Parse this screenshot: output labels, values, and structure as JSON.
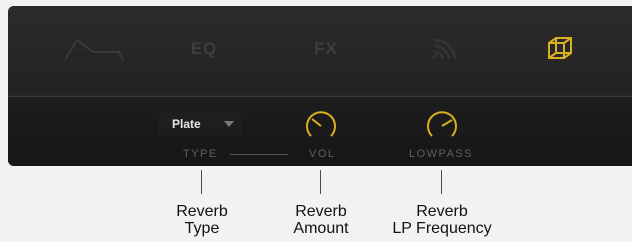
{
  "tabs": [
    {
      "id": "envelope",
      "label": "",
      "icon": "envelope-icon"
    },
    {
      "id": "eq",
      "label": "EQ",
      "icon": ""
    },
    {
      "id": "fx",
      "label": "FX",
      "icon": ""
    },
    {
      "id": "delay",
      "label": "",
      "icon": "delay-waves-icon"
    },
    {
      "id": "reverb",
      "label": "",
      "icon": "reverb-cube-icon",
      "active": true
    }
  ],
  "reverb": {
    "type": {
      "label": "TYPE",
      "value": "Plate"
    },
    "vol": {
      "label": "VOL"
    },
    "lowpass": {
      "label": "LOWPASS"
    }
  },
  "callouts": {
    "type": [
      "Reverb",
      "Type"
    ],
    "amount": [
      "Reverb",
      "Amount"
    ],
    "frequency": [
      "Reverb",
      "LP Frequency"
    ]
  },
  "colors": {
    "accent": "#d9b01e",
    "panel": "#262626",
    "inactive": "#3e3e3e"
  }
}
